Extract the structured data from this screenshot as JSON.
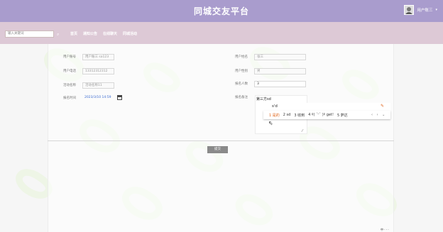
{
  "header": {
    "site_title": "同城交友平台",
    "user_name": "用户账三",
    "user_caret": "▾"
  },
  "nav": {
    "search_placeholder": "输入关键词",
    "items": [
      "首页",
      "通知公告",
      "在线聊天",
      "同城活动"
    ]
  },
  "form": {
    "account_label": "用户账号",
    "account_value": "用户账三 sa123",
    "name_label": "用户姓名",
    "name_value": "张三",
    "phone_label": "用户电话",
    "phone_value": "13312312312",
    "gender_label": "用户性别",
    "gender_value": "男",
    "activity_label": "活动名称",
    "activity_value": "活动名称11",
    "count_label": "报名人数",
    "count_value": "3",
    "time_label": "报名时间",
    "time_value": "2023/3/10 14:59",
    "note_label": "报名备注",
    "note_text": "第三方sd"
  },
  "ime": {
    "input_text": "s'd",
    "candidates": [
      "1 是的",
      "2 sd",
      "3 收到",
      "4 ୧( ˊᵕˋ )୨ get!",
      "5 萨达"
    ],
    "nav": "‹ › ⌄"
  },
  "submit_label": "提交",
  "corner_text": "中 · · ·"
}
